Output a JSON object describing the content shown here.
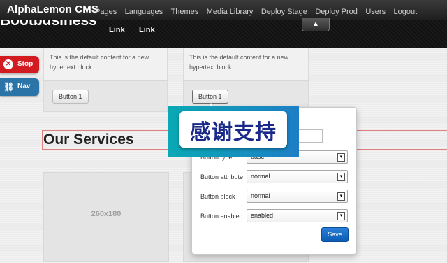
{
  "admin_bar": {
    "brand": "AlphaLemon CMS",
    "nav": [
      "Pages",
      "Languages",
      "Themes",
      "Media Library",
      "Deploy Stage",
      "Deploy Prod",
      "Users",
      "Logout"
    ],
    "toggle_icon": "arrow-up-icon",
    "toggle_glyph": "▲"
  },
  "site_header": {
    "title": "Bootbusiness",
    "links": [
      "Link",
      "Link"
    ]
  },
  "side_buttons": {
    "stop": {
      "label": "Stop",
      "color": "#d21c22",
      "glyph": "✕"
    },
    "nav": {
      "label": "Nav",
      "color": "#2a74a8",
      "glyph": "⛓"
    }
  },
  "hypertext_blocks": [
    {
      "text": "This is the default content for a new hypertext block",
      "button": "Button 1"
    },
    {
      "text": "This is the default content for a new hypertext block",
      "button": "Button 1"
    }
  ],
  "services": {
    "title": "Our Services",
    "thumbnail_label": "260x180"
  },
  "popover": {
    "properties": [
      {
        "label": "Button type",
        "value": "base"
      },
      {
        "label": "Button attribute",
        "value": "normal"
      },
      {
        "label": "Button block",
        "value": "normal"
      },
      {
        "label": "Button enabled",
        "value": "enabled"
      }
    ],
    "save_label": "Save",
    "accent_color": "#0a5bb3"
  },
  "promo_overlay": {
    "text": "感谢支持"
  }
}
